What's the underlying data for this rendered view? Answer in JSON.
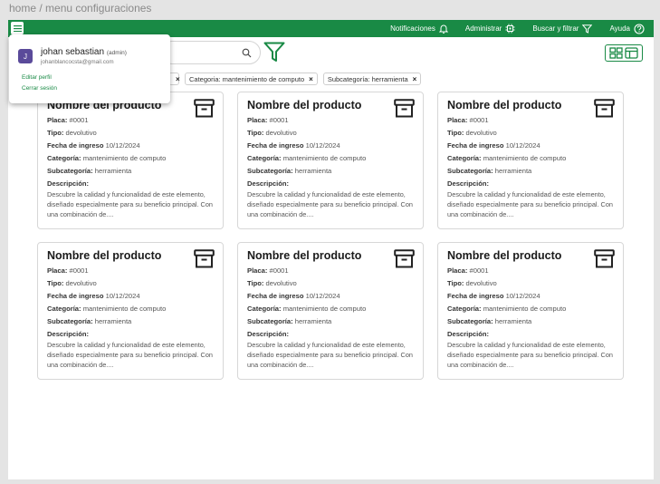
{
  "breadcrumb": "home / menu configuraciones",
  "colors": {
    "brand": "#198a45",
    "avatar": "#5a4a9a"
  },
  "nav": [
    {
      "label": "Notificaciones",
      "icon": "bell-icon"
    },
    {
      "label": "Administrar",
      "icon": "chip-icon"
    },
    {
      "label": "Buscar y filtrar",
      "icon": "filter-icon"
    },
    {
      "label": "Ayuda",
      "icon": "help-icon"
    }
  ],
  "search": {
    "placeholder": ""
  },
  "chips": [
    {
      "label": "Categoria: mantenimiento de computo"
    },
    {
      "label": "Subcategoría: herramienta"
    }
  ],
  "profile": {
    "initial": "J",
    "name": "johan sebastian",
    "role": "(admin)",
    "email": "johanblancocsta@gmail.com",
    "edit_label": "Editar perfil",
    "logout_label": "Cerrar sesión"
  },
  "card_labels": {
    "placa": "Placa:",
    "tipo": "Tipo:",
    "fecha": "Fecha de ingreso",
    "categoria": "Categoría:",
    "subcategoria": "Subcategoría:",
    "descripcion": "Descripción:"
  },
  "products": [
    {
      "name": "Nombre del producto",
      "placa": "#0001",
      "tipo": "devolutivo",
      "fecha": "10/12/2024",
      "categoria": "mantenimiento de computo",
      "subcategoria": "herramienta",
      "descripcion": "Descubre la calidad y funcionalidad de este elemento, diseñado especialmente para su beneficio principal. Con una combinación de...."
    },
    {
      "name": "Nombre del producto",
      "placa": "#0001",
      "tipo": "devolutivo",
      "fecha": "10/12/2024",
      "categoria": "mantenimiento de computo",
      "subcategoria": "herramienta",
      "descripcion": "Descubre la calidad y funcionalidad de este elemento, diseñado especialmente para su beneficio principal. Con una combinación de...."
    },
    {
      "name": "Nombre del producto",
      "placa": "#0001",
      "tipo": "devolutivo",
      "fecha": "10/12/2024",
      "categoria": "mantenimiento de computo",
      "subcategoria": "herramienta",
      "descripcion": "Descubre la calidad y funcionalidad de este elemento, diseñado especialmente para su beneficio principal. Con una combinación de...."
    },
    {
      "name": "Nombre del producto",
      "placa": "#0001",
      "tipo": "devolutivo",
      "fecha": "10/12/2024",
      "categoria": "mantenimiento de computo",
      "subcategoria": "herramienta",
      "descripcion": "Descubre la calidad y funcionalidad de este elemento, diseñado especialmente para su beneficio principal. Con una combinación de...."
    },
    {
      "name": "Nombre del producto",
      "placa": "#0001",
      "tipo": "devolutivo",
      "fecha": "10/12/2024",
      "categoria": "mantenimiento de computo",
      "subcategoria": "herramienta",
      "descripcion": "Descubre la calidad y funcionalidad de este elemento, diseñado especialmente para su beneficio principal. Con una combinación de...."
    },
    {
      "name": "Nombre del producto",
      "placa": "#0001",
      "tipo": "devolutivo",
      "fecha": "10/12/2024",
      "categoria": "mantenimiento de computo",
      "subcategoria": "herramienta",
      "descripcion": "Descubre la calidad y funcionalidad de este elemento, diseñado especialmente para su beneficio principal. Con una combinación de...."
    }
  ]
}
